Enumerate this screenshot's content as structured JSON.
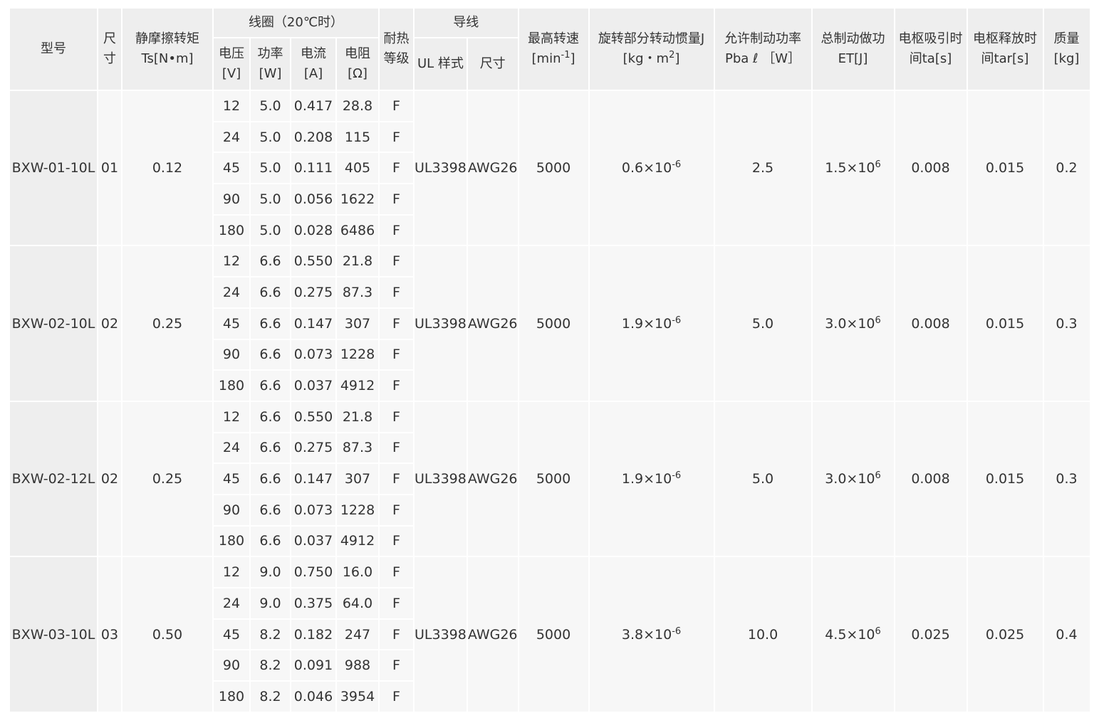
{
  "headers": {
    "model": "型号",
    "size": "尺寸",
    "torque": "静摩擦转矩Ts[N•m]",
    "coil": "线圈（20℃时）",
    "voltage": "电压[V]",
    "power": "功率[W]",
    "current": "电流[A]",
    "resistance": "电阻[Ω]",
    "heat_class": "耐热等级",
    "lead": "导线",
    "ul_style": "UL 样式",
    "lead_size": "尺寸",
    "max_speed": "最高转速",
    "max_speed_unit_pre": "[min",
    "max_speed_unit_exp": "-1",
    "max_speed_unit_post": "]",
    "inertia": "旋转部分转动惯量J",
    "inertia_unit_pre": "[kg・m",
    "inertia_unit_exp": "2",
    "inertia_unit_post": "]",
    "braking_power": "允许制动功率Pba ℓ ［W］",
    "total_work": "总制动做功ET[J]",
    "attract_time": "电枢吸引时间ta[s]",
    "release_time": "电枢释放时间tar[s]",
    "mass": "质量[kg]"
  },
  "models": [
    {
      "model": "BXW-01-10L",
      "size": "01",
      "torque": "0.12",
      "ul_style": "UL3398",
      "lead_size": "AWG26",
      "max_speed": "5000",
      "inertia_base": "0.6×10",
      "inertia_exp": "-6",
      "braking_power": "2.5",
      "work_base": "1.5×10",
      "work_exp": "6",
      "attract_time": "0.008",
      "release_time": "0.015",
      "mass": "0.2",
      "rows": [
        {
          "voltage": "12",
          "power": "5.0",
          "current": "0.417",
          "resistance": "28.8",
          "heat_class": "F"
        },
        {
          "voltage": "24",
          "power": "5.0",
          "current": "0.208",
          "resistance": "115",
          "heat_class": "F"
        },
        {
          "voltage": "45",
          "power": "5.0",
          "current": "0.111",
          "resistance": "405",
          "heat_class": "F"
        },
        {
          "voltage": "90",
          "power": "5.0",
          "current": "0.056",
          "resistance": "1622",
          "heat_class": "F"
        },
        {
          "voltage": "180",
          "power": "5.0",
          "current": "0.028",
          "resistance": "6486",
          "heat_class": "F"
        }
      ]
    },
    {
      "model": "BXW-02-10L",
      "size": "02",
      "torque": "0.25",
      "ul_style": "UL3398",
      "lead_size": "AWG26",
      "max_speed": "5000",
      "inertia_base": "1.9×10",
      "inertia_exp": "-6",
      "braking_power": "5.0",
      "work_base": "3.0×10",
      "work_exp": "6",
      "attract_time": "0.008",
      "release_time": "0.015",
      "mass": "0.3",
      "rows": [
        {
          "voltage": "12",
          "power": "6.6",
          "current": "0.550",
          "resistance": "21.8",
          "heat_class": "F"
        },
        {
          "voltage": "24",
          "power": "6.6",
          "current": "0.275",
          "resistance": "87.3",
          "heat_class": "F"
        },
        {
          "voltage": "45",
          "power": "6.6",
          "current": "0.147",
          "resistance": "307",
          "heat_class": "F"
        },
        {
          "voltage": "90",
          "power": "6.6",
          "current": "0.073",
          "resistance": "1228",
          "heat_class": "F"
        },
        {
          "voltage": "180",
          "power": "6.6",
          "current": "0.037",
          "resistance": "4912",
          "heat_class": "F"
        }
      ]
    },
    {
      "model": "BXW-02-12L",
      "size": "02",
      "torque": "0.25",
      "ul_style": "UL3398",
      "lead_size": "AWG26",
      "max_speed": "5000",
      "inertia_base": "1.9×10",
      "inertia_exp": "-6",
      "braking_power": "5.0",
      "work_base": "3.0×10",
      "work_exp": "6",
      "attract_time": "0.008",
      "release_time": "0.015",
      "mass": "0.3",
      "rows": [
        {
          "voltage": "12",
          "power": "6.6",
          "current": "0.550",
          "resistance": "21.8",
          "heat_class": "F"
        },
        {
          "voltage": "24",
          "power": "6.6",
          "current": "0.275",
          "resistance": "87.3",
          "heat_class": "F"
        },
        {
          "voltage": "45",
          "power": "6.6",
          "current": "0.147",
          "resistance": "307",
          "heat_class": "F"
        },
        {
          "voltage": "90",
          "power": "6.6",
          "current": "0.073",
          "resistance": "1228",
          "heat_class": "F"
        },
        {
          "voltage": "180",
          "power": "6.6",
          "current": "0.037",
          "resistance": "4912",
          "heat_class": "F"
        }
      ]
    },
    {
      "model": "BXW-03-10L",
      "size": "03",
      "torque": "0.50",
      "ul_style": "UL3398",
      "lead_size": "AWG26",
      "max_speed": "5000",
      "inertia_base": "3.8×10",
      "inertia_exp": "-6",
      "braking_power": "10.0",
      "work_base": "4.5×10",
      "work_exp": "6",
      "attract_time": "0.025",
      "release_time": "0.025",
      "mass": "0.4",
      "rows": [
        {
          "voltage": "12",
          "power": "9.0",
          "current": "0.750",
          "resistance": "16.0",
          "heat_class": "F"
        },
        {
          "voltage": "24",
          "power": "9.0",
          "current": "0.375",
          "resistance": "64.0",
          "heat_class": "F"
        },
        {
          "voltage": "45",
          "power": "8.2",
          "current": "0.182",
          "resistance": "247",
          "heat_class": "F"
        },
        {
          "voltage": "90",
          "power": "8.2",
          "current": "0.091",
          "resistance": "988",
          "heat_class": "F"
        },
        {
          "voltage": "180",
          "power": "8.2",
          "current": "0.046",
          "resistance": "3954",
          "heat_class": "F"
        }
      ]
    }
  ]
}
